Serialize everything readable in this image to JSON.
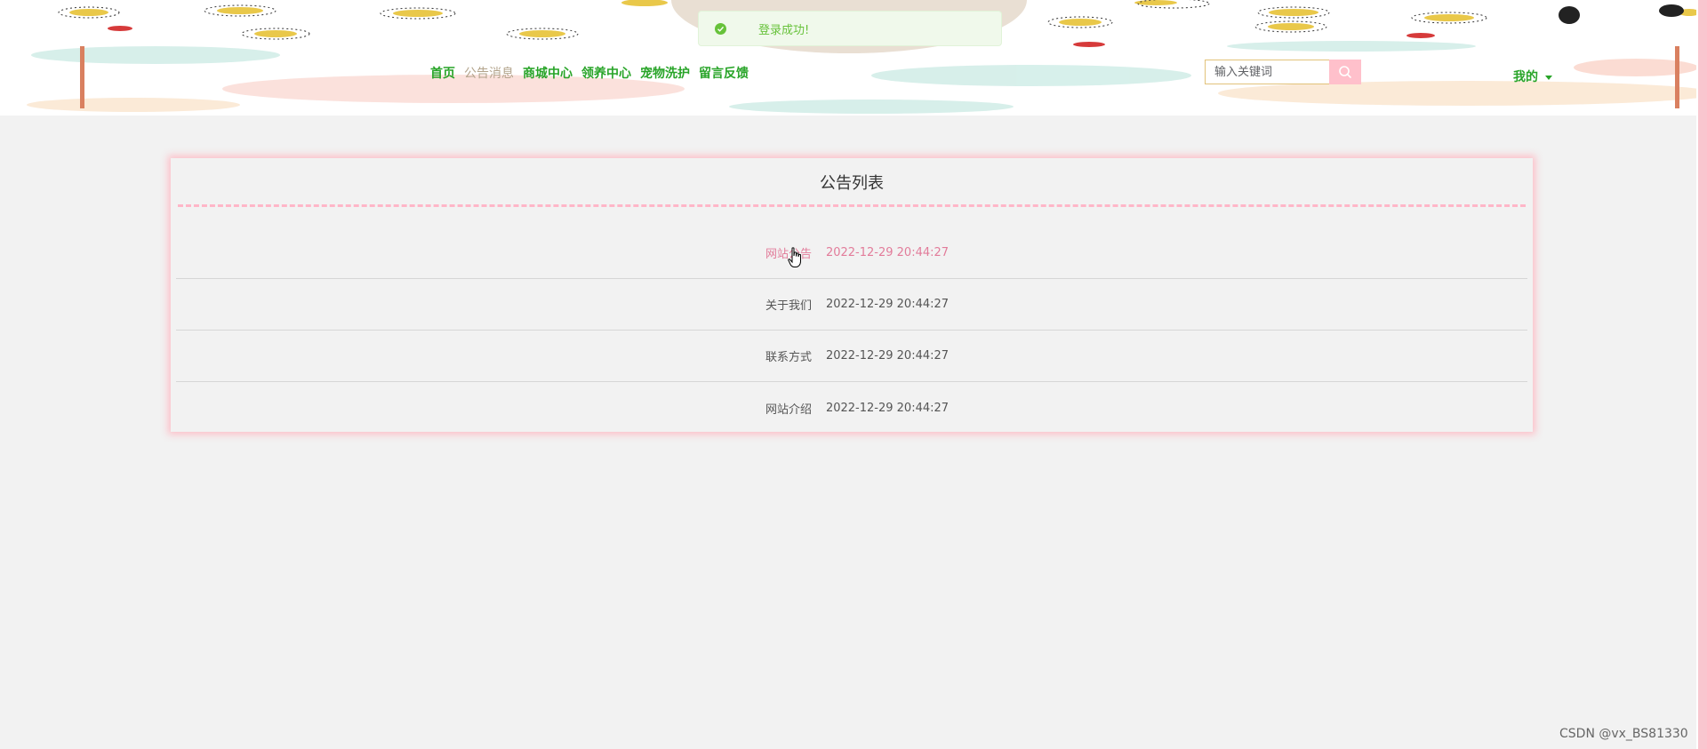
{
  "nav": {
    "items": [
      {
        "label": "首页",
        "active": false
      },
      {
        "label": "公告消息",
        "active": true
      },
      {
        "label": "商城中心",
        "active": false
      },
      {
        "label": "领养中心",
        "active": false
      },
      {
        "label": "宠物洗护",
        "active": false
      },
      {
        "label": "留言反馈",
        "active": false
      }
    ]
  },
  "search": {
    "placeholder": "输入关键词"
  },
  "user_menu": {
    "label": "我的"
  },
  "toast": {
    "message": "登录成功!"
  },
  "notices": {
    "title": "公告列表",
    "rows": [
      {
        "title": "网站公告",
        "time": "2022-12-29 20:44:27"
      },
      {
        "title": "关于我们",
        "time": "2022-12-29 20:44:27"
      },
      {
        "title": "联系方式",
        "time": "2022-12-29 20:44:27"
      },
      {
        "title": "网站介绍",
        "time": "2022-12-29 20:44:27"
      }
    ]
  },
  "watermark": "CSDN @vx_BS81330",
  "colors": {
    "nav_green": "#28a428",
    "nav_active": "#b3a48c",
    "accent_pink": "#ffc0cb",
    "hover_pink": "#e27c9a",
    "success_green": "#67c23a"
  }
}
